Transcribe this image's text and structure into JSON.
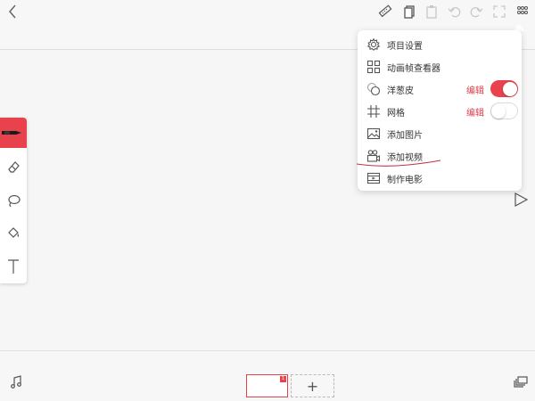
{
  "toolbar": {
    "back_icon": "chevron-left-icon",
    "ruler_icon": "ruler-icon",
    "copy_icon": "copy-icon",
    "paste_icon": "paste-icon",
    "undo_icon": "undo-icon",
    "redo_icon": "redo-icon",
    "fullscreen_icon": "fullscreen-icon",
    "more_icon": "more-icon"
  },
  "menu": {
    "items": [
      {
        "label": "项目设置",
        "icon": "gear-icon"
      },
      {
        "label": "动画帧查看器",
        "icon": "grid-icon"
      },
      {
        "label": "洋葱皮",
        "icon": "onion-skin-icon",
        "edit_label": "编辑",
        "toggle": true
      },
      {
        "label": "网格",
        "icon": "hash-grid-icon",
        "edit_label": "编辑",
        "toggle": false
      },
      {
        "label": "添加图片",
        "icon": "image-icon"
      },
      {
        "label": "添加视频",
        "icon": "video-icon"
      },
      {
        "label": "制作电影",
        "icon": "film-icon"
      }
    ]
  },
  "tools": [
    {
      "name": "brush",
      "icon": "brush-icon",
      "active": true
    },
    {
      "name": "eraser",
      "icon": "eraser-icon",
      "active": false
    },
    {
      "name": "lasso",
      "icon": "lasso-icon",
      "active": false
    },
    {
      "name": "fill",
      "icon": "paint-bucket-icon",
      "active": false
    },
    {
      "name": "text",
      "icon": "text-icon",
      "active": false
    }
  ],
  "timeline": {
    "frame_badge": "1",
    "add_frame_label": "+"
  },
  "colors": {
    "accent": "#e8424d",
    "edit_text": "#d9424c",
    "icon_gray": "#666666",
    "disabled_gray": "#c8c8c8"
  }
}
